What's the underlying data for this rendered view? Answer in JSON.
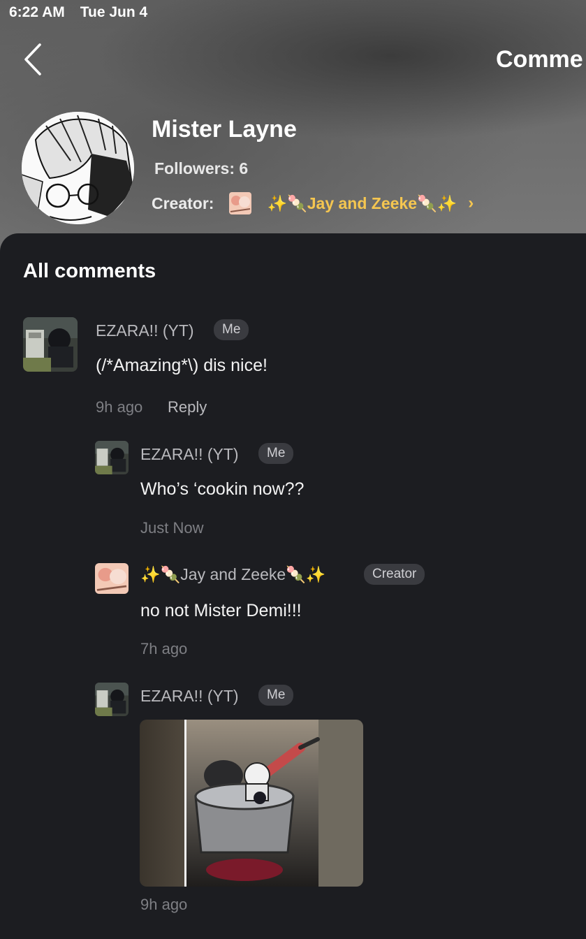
{
  "status": {
    "time": "6:22 AM",
    "date": "Tue Jun 4"
  },
  "header": {
    "title": "Comme",
    "back_icon": "chevron-left-icon"
  },
  "profile": {
    "name": "Mister Layne",
    "followers": "Followers: 6",
    "creator_label": "Creator:",
    "creator_name": "✨🍡Jay and Zeeke🍡✨",
    "chevron_icon": "chevron-right-icon"
  },
  "section_title": "All comments",
  "comments": [
    {
      "user": "EZARA!! (YT)",
      "tag": "Me",
      "text": "(/*Amazing*\\) dis nice!",
      "time": "9h ago",
      "reply_label": "Reply"
    },
    {
      "user": "EZARA!! (YT)",
      "tag": "Me",
      "text": "Who’s ‘cookin now??",
      "time": "Just Now"
    },
    {
      "user": "✨🍡Jay and Zeeke🍡✨",
      "tag": "Creator",
      "text": "no not Mister Demi!!!",
      "time": "7h ago"
    },
    {
      "user": "EZARA!! (YT)",
      "tag": "Me",
      "image": "cooking-pot-photo",
      "time": "9h ago"
    }
  ],
  "colors": {
    "background": "#1c1d21",
    "creator_gold": "#f5c650",
    "tag_bg": "#3a3b40"
  }
}
